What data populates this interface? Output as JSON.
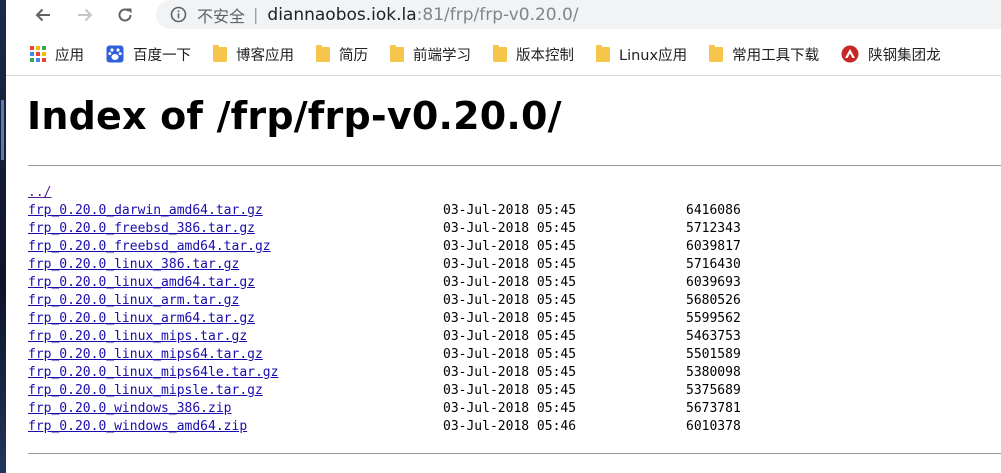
{
  "browser": {
    "security_label": "不安全",
    "url_separator": "|",
    "url_host": "diannaobos.iok.la",
    "url_rest": ":81/frp/frp-v0.20.0/"
  },
  "bookmarks": [
    {
      "label": "应用",
      "icon": "apps-grid-icon"
    },
    {
      "label": "百度一下",
      "icon": "baidu-paw-icon"
    },
    {
      "label": "博客应用",
      "icon": "folder-icon"
    },
    {
      "label": "简历",
      "icon": "folder-icon"
    },
    {
      "label": "前端学习",
      "icon": "folder-icon"
    },
    {
      "label": "版本控制",
      "icon": "folder-icon"
    },
    {
      "label": "Linux应用",
      "icon": "folder-icon"
    },
    {
      "label": "常用工具下载",
      "icon": "folder-icon"
    },
    {
      "label": "陕钢集团龙",
      "icon": "company-logo-icon"
    }
  ],
  "page": {
    "title": "Index of /frp/frp-v0.20.0/",
    "parent_link": "../",
    "files": [
      {
        "name": "frp_0.20.0_darwin_amd64.tar.gz",
        "date": "03-Jul-2018 05:45",
        "size": "6416086"
      },
      {
        "name": "frp_0.20.0_freebsd_386.tar.gz",
        "date": "03-Jul-2018 05:45",
        "size": "5712343"
      },
      {
        "name": "frp_0.20.0_freebsd_amd64.tar.gz",
        "date": "03-Jul-2018 05:45",
        "size": "6039817"
      },
      {
        "name": "frp_0.20.0_linux_386.tar.gz",
        "date": "03-Jul-2018 05:45",
        "size": "5716430"
      },
      {
        "name": "frp_0.20.0_linux_amd64.tar.gz",
        "date": "03-Jul-2018 05:45",
        "size": "6039693"
      },
      {
        "name": "frp_0.20.0_linux_arm.tar.gz",
        "date": "03-Jul-2018 05:45",
        "size": "5680526"
      },
      {
        "name": "frp_0.20.0_linux_arm64.tar.gz",
        "date": "03-Jul-2018 05:45",
        "size": "5599562"
      },
      {
        "name": "frp_0.20.0_linux_mips.tar.gz",
        "date": "03-Jul-2018 05:45",
        "size": "5463753"
      },
      {
        "name": "frp_0.20.0_linux_mips64.tar.gz",
        "date": "03-Jul-2018 05:45",
        "size": "5501589"
      },
      {
        "name": "frp_0.20.0_linux_mips64le.tar.gz",
        "date": "03-Jul-2018 05:45",
        "size": "5380098"
      },
      {
        "name": "frp_0.20.0_linux_mipsle.tar.gz",
        "date": "03-Jul-2018 05:45",
        "size": "5375689"
      },
      {
        "name": "frp_0.20.0_windows_386.zip",
        "date": "03-Jul-2018 05:45",
        "size": "5673781"
      },
      {
        "name": "frp_0.20.0_windows_amd64.zip",
        "date": "03-Jul-2018 05:46",
        "size": "6010378"
      }
    ]
  },
  "colors": {
    "link": "#1a0dab",
    "visited_link": "#551a8b",
    "folder": "#f6c64c",
    "omnibox_bg": "#f1f3f4"
  }
}
